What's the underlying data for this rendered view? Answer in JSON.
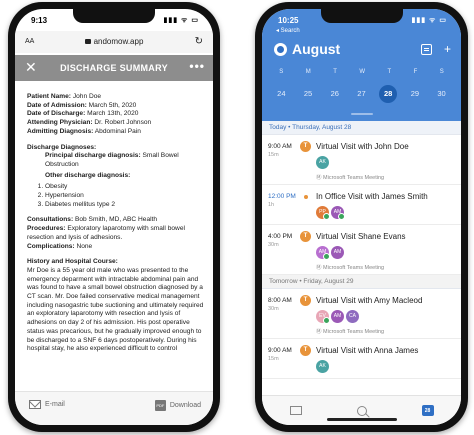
{
  "left_phone": {
    "status_time": "9:13",
    "status_icons": "▮▮▮ ᯤ ▭",
    "browser": {
      "aa_label": "AA",
      "url": "andomow.app",
      "reload_icon": "↻"
    },
    "header": {
      "close_icon": "✕",
      "title": "DISCHARGE SUMMARY",
      "more_icon": "•••"
    },
    "doc": {
      "patient_label": "Patient Name:",
      "patient_value": " John Doe",
      "admission_label": "Date of Admission:",
      "admission_value": " March 5th, 2020",
      "discharge_label": "Date of Discharge:",
      "discharge_value": " March 13th, 2020",
      "physician_label": "Attending Physician:",
      "physician_value": " Dr. Robert Johnson",
      "adm_diag_label": "Admitting Diagnosis:",
      "adm_diag_value": " Abdominal Pain",
      "diagnoses_heading": "Discharge Diagnoses:",
      "principal_label": "Principal discharge diagnosis:",
      "principal_value": " Small Bowel Obstruction",
      "other_label": "Other discharge diagnosis:",
      "other_items": [
        "Obesity",
        "Hypertension",
        "Diabetes mellitus type 2"
      ],
      "consult_label": "Consultations:",
      "consult_value": " Bob Smith, MD, ABC Health",
      "proc_label": "Procedures:",
      "proc_value": " Exploratory laparotomy with small bowel resection and lysis of adhesions.",
      "comp_label": "Complications:",
      "comp_value": " None",
      "history_heading": "History and Hospital Course:",
      "history_text": "Mr Doe is a 55 year old male who was presented to the emergency deparment with intractable abdominal pain and was found to have a small bowel obstruction diagnosed by a CT scan. Mr. Doe failed conservative medical management including nasogastric tube suctioning and ultimately required an exploratory laparotomy with resection and lysis of adhesions on day 2 of his admission. His post operative status was precarious, but he gradually improved enough to be discharged to a SNF 6 days postoperatively.  During his hospital stay, he also experienced difficult to control"
    },
    "bottom": {
      "email_label": "E-mail",
      "download_label": "Download",
      "pdf_icon": "PDF"
    }
  },
  "right_phone": {
    "status_time": "10:25",
    "status_icons": "▮▮▮ ᯤ ▭",
    "back_search": "◂ Search",
    "calendar_title": "August",
    "add_icon": "+",
    "weekdays": [
      "S",
      "M",
      "T",
      "W",
      "T",
      "F",
      "S"
    ],
    "dates": [
      "24",
      "25",
      "26",
      "27",
      "28",
      "29",
      "30"
    ],
    "selected_date_index": 4,
    "today_header_prefix": "Today • Thursday, ",
    "today_header_date": "August 28",
    "tomorrow_header_prefix": "Tomorrow • Friday, ",
    "tomorrow_header_date": "August 29",
    "events_today": [
      {
        "time": "9:00 AM",
        "duration": "15m",
        "title": "Virtual Visit with John Doe",
        "location": "Microsoft Teams Meeting",
        "avatars": [
          {
            "initials": "AK",
            "color": "#4aa3a3",
            "accepted": false
          }
        ]
      },
      {
        "time": "12:00 PM",
        "duration": "1h",
        "title": "In Office Visit with James Smith",
        "location": "",
        "avatars": [
          {
            "initials": "PP",
            "color": "#e07b39",
            "accepted": true
          },
          {
            "initials": "AM",
            "color": "#9b59b6",
            "accepted": true
          }
        ]
      },
      {
        "time": "4:00 PM",
        "duration": "30m",
        "title": "Virtual Visit Shane Evans",
        "location": "Microsoft Teams Meeting",
        "avatars": [
          {
            "initials": "AM",
            "color": "#b86fd0",
            "accepted": true
          },
          {
            "initials": "AM",
            "color": "#9b59b6",
            "accepted": false
          }
        ]
      }
    ],
    "events_tomorrow": [
      {
        "time": "8:00 AM",
        "duration": "30m",
        "title": "Virtual Visit with Amy Macleod",
        "location": "Microsoft Teams Meeting",
        "avatars": [
          {
            "initials": "EV",
            "color": "#e8a6b6",
            "accepted": true
          },
          {
            "initials": "AM",
            "color": "#9b59b6",
            "accepted": false
          },
          {
            "initials": "CA",
            "color": "#8e6bbf",
            "accepted": false
          }
        ]
      },
      {
        "time": "9:00 AM",
        "duration": "15m",
        "title": "Virtual Visit with Anna James",
        "location": "",
        "avatars": [
          {
            "initials": "AK",
            "color": "#4aa3a3",
            "accepted": false
          }
        ]
      }
    ],
    "tab_calendar_day": "28"
  }
}
